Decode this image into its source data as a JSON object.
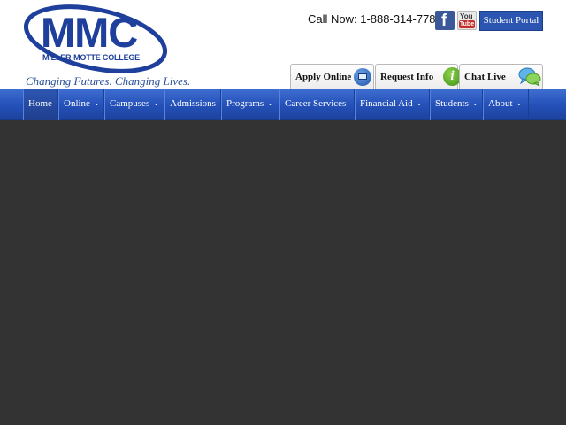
{
  "header": {
    "logo": {
      "mark": "MMC",
      "subtext": "MILLER-MOTTE COLLEGE",
      "brand_color": "#1e3f9b"
    },
    "tagline": "Changing Futures.  Changing Lives.",
    "call_now": "Call Now: 1-888-314-7780",
    "social": {
      "facebook_icon": "facebook-icon",
      "youtube_icon": "youtube-icon",
      "facebook_glyph": "f",
      "youtube_you": "You",
      "youtube_tube": "Tube"
    },
    "student_portal_label": "Student Portal"
  },
  "action_tabs": {
    "apply_label": "Apply Online",
    "apply_icon": "monitor-icon",
    "info_label": "Request Info",
    "info_icon": "info-icon",
    "info_glyph": "i",
    "chat_label": "Chat Live",
    "chat_icon": "chat-bubbles-icon"
  },
  "nav": {
    "items": [
      {
        "label": "Home",
        "dropdown": false,
        "active": true
      },
      {
        "label": "Online",
        "dropdown": true
      },
      {
        "label": "Campuses",
        "dropdown": true
      },
      {
        "label": "Admissions",
        "dropdown": false
      },
      {
        "label": "Programs",
        "dropdown": true
      },
      {
        "label": "Career Services",
        "dropdown": false
      },
      {
        "label": "Financial Aid",
        "dropdown": true
      },
      {
        "label": "Students",
        "dropdown": true
      },
      {
        "label": "About",
        "dropdown": true
      }
    ],
    "chevron_glyph": "⌄",
    "bar_color": "#2450b8"
  },
  "colors": {
    "page_background": "#333333",
    "accent": "#1e3f9b"
  }
}
